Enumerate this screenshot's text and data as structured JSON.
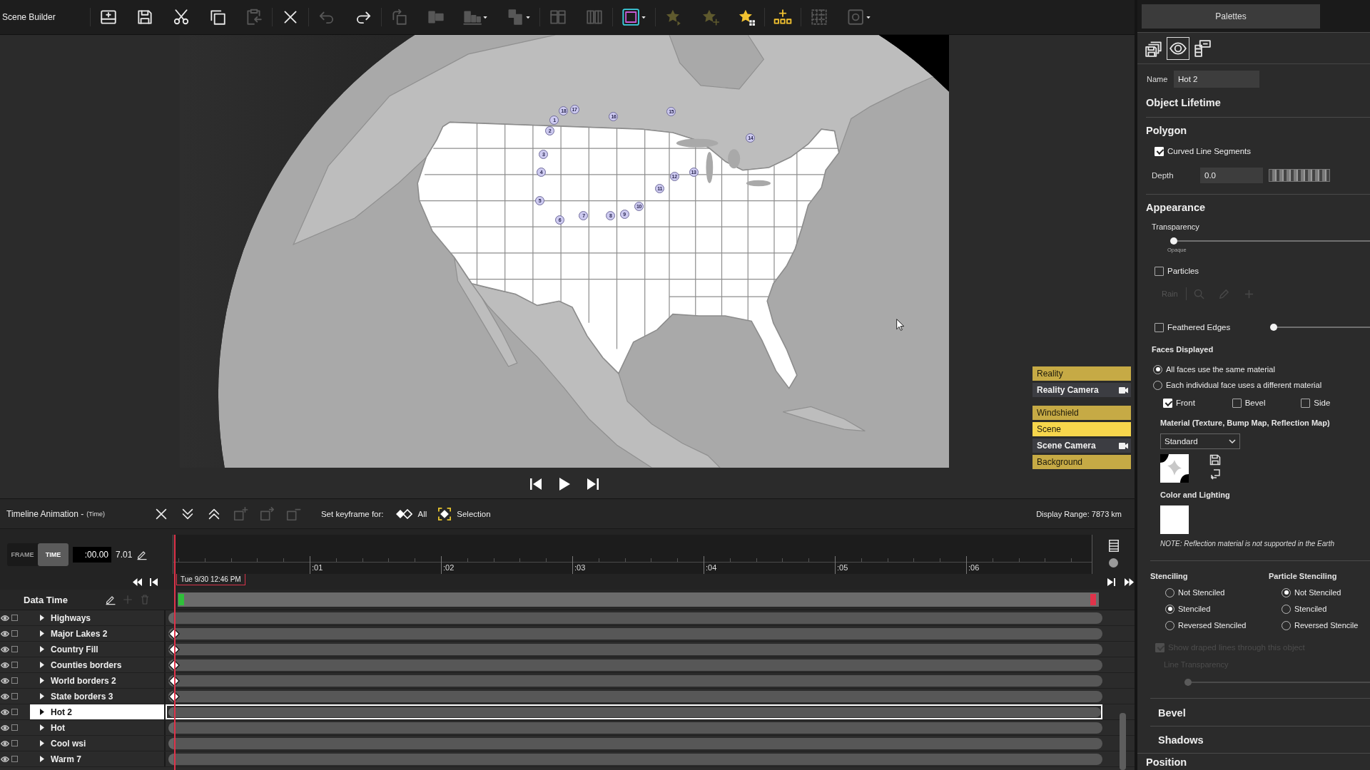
{
  "app": {
    "title": "Scene Builder"
  },
  "toolbar": {
    "groups": [
      {
        "buttons": [
          {
            "kind": "add",
            "disabled": false
          },
          {
            "kind": "save",
            "disabled": false
          },
          {
            "kind": "cut",
            "disabled": false
          },
          {
            "kind": "copy",
            "disabled": false
          },
          {
            "kind": "paste",
            "disabled": true
          }
        ]
      },
      {
        "buttons": [
          {
            "kind": "delete",
            "disabled": false
          }
        ]
      },
      {
        "buttons": [
          {
            "kind": "undo",
            "disabled": true
          },
          {
            "kind": "redo",
            "disabled": false
          }
        ]
      },
      {
        "buttons": [
          {
            "kind": "rotate",
            "disabled": true
          },
          {
            "kind": "align",
            "disabled": true
          },
          {
            "kind": "distribute",
            "disabled": true
          },
          {
            "kind": "group",
            "disabled": true
          }
        ]
      },
      {
        "buttons": [
          {
            "kind": "columns",
            "disabled": true
          },
          {
            "kind": "rows",
            "disabled": true
          }
        ]
      },
      {
        "buttons": [
          {
            "kind": "frame",
            "disabled": false
          }
        ]
      },
      {
        "buttons": [
          {
            "kind": "star",
            "disabled": true
          },
          {
            "kind": "starplus",
            "disabled": true
          },
          {
            "kind": "stargrid",
            "disabled": false
          }
        ]
      },
      {
        "buttons": [
          {
            "kind": "dots",
            "disabled": false
          }
        ]
      },
      {
        "buttons": [
          {
            "kind": "grid",
            "disabled": true
          },
          {
            "kind": "link",
            "disabled": true
          }
        ]
      }
    ]
  },
  "viewport": {
    "markers": [
      "1",
      "2",
      "3",
      "4",
      "5",
      "6",
      "7",
      "8",
      "9",
      "10",
      "11",
      "12",
      "13",
      "14",
      "15",
      "16",
      "17",
      "18"
    ],
    "layer_groups": [
      {
        "layers": [
          {
            "label": "Reality",
            "kind": "layer",
            "selected": false
          },
          {
            "label": "Reality Camera",
            "kind": "camera",
            "selected": false
          }
        ]
      },
      {
        "layers": [
          {
            "label": "Windshield",
            "kind": "layer",
            "selected": false
          },
          {
            "label": "Scene",
            "kind": "layer",
            "selected": true
          },
          {
            "label": "Scene Camera",
            "kind": "camera",
            "selected": false
          },
          {
            "label": "Background",
            "kind": "layer",
            "selected": false
          }
        ]
      }
    ]
  },
  "timeline": {
    "title": "Timeline Animation -",
    "subtitle": "(Time)",
    "tools": [
      {
        "kind": "close",
        "disabled": false
      },
      {
        "kind": "down",
        "disabled": false
      },
      {
        "kind": "up",
        "disabled": false
      },
      {
        "kind": "addkey",
        "disabled": true
      },
      {
        "kind": "movekey",
        "disabled": true
      },
      {
        "kind": "removekey",
        "disabled": true
      }
    ],
    "keyframe_label": "Set keyframe for:",
    "keyframe_options": [
      {
        "label": "All",
        "kind": "all"
      },
      {
        "label": "Selection",
        "kind": "selection"
      }
    ],
    "display_range": "Display Range: 7873 km",
    "modes": [
      {
        "label": "FRAME",
        "selected": false
      },
      {
        "label": "TIME",
        "selected": true
      }
    ],
    "time_value": ":00.00",
    "duration": "7.01",
    "ticks": [
      ":01",
      ":02",
      ":03",
      ":04",
      ":05",
      ":06"
    ],
    "date": "Tue 9/30 12:46 PM",
    "data_time": {
      "label": "Data Time",
      "tools": [
        {
          "kind": "edit",
          "disabled": false
        },
        {
          "kind": "add",
          "disabled": true
        },
        {
          "kind": "delete",
          "disabled": true
        }
      ]
    },
    "rows": [
      {
        "name": "Highways",
        "visible": true,
        "checked": false,
        "keyframe": false,
        "selected": false
      },
      {
        "name": "Major Lakes 2",
        "visible": true,
        "checked": false,
        "keyframe": true,
        "selected": false
      },
      {
        "name": "Country Fill",
        "visible": true,
        "checked": false,
        "keyframe": true,
        "selected": false
      },
      {
        "name": "Counties borders",
        "visible": true,
        "checked": false,
        "keyframe": true,
        "selected": false
      },
      {
        "name": "World borders 2",
        "visible": true,
        "checked": false,
        "keyframe": true,
        "selected": false
      },
      {
        "name": "State borders 3",
        "visible": true,
        "checked": false,
        "keyframe": true,
        "selected": false
      },
      {
        "name": "Hot 2",
        "visible": true,
        "checked": false,
        "keyframe": false,
        "selected": true
      },
      {
        "name": "Hot",
        "visible": true,
        "checked": false,
        "keyframe": false,
        "selected": false
      },
      {
        "name": "Cool wsi",
        "visible": true,
        "checked": false,
        "keyframe": false,
        "selected": false
      },
      {
        "name": "Warm 7",
        "visible": true,
        "checked": false,
        "keyframe": false,
        "selected": false
      }
    ]
  },
  "palettes": {
    "title": "Palettes",
    "tabs": [
      {
        "kind": "layers",
        "selected": false
      },
      {
        "kind": "view",
        "selected": true
      },
      {
        "kind": "list",
        "selected": false
      }
    ],
    "name": {
      "label": "Name",
      "value": "Hot 2"
    },
    "object_lifetime": {
      "title": "Object Lifetime"
    },
    "polygon": {
      "title": "Polygon",
      "curved": {
        "label": "Curved Line Segments",
        "checked": true
      },
      "depth": {
        "label": "Depth",
        "value": "0.0"
      }
    },
    "appearance": {
      "title": "Appearance",
      "transparency": {
        "label": "Transparency",
        "level": 0.0,
        "min_label": "Opaque"
      },
      "particles": {
        "label": "Particles",
        "checked": false
      },
      "particle_type": {
        "value": "Rain",
        "disabled": true
      },
      "feathered": {
        "label": "Feathered Edges",
        "checked": false,
        "level": 0.0
      },
      "faces": {
        "title": "Faces Displayed",
        "options": [
          {
            "label": "All faces use the same material",
            "selected": true
          },
          {
            "label": "Each individual face uses a different material",
            "selected": false
          }
        ],
        "sides": [
          {
            "label": "Front",
            "checked": true
          },
          {
            "label": "Bevel",
            "checked": false
          },
          {
            "label": "Side",
            "checked": false
          }
        ]
      },
      "material": {
        "title": "Material (Texture, Bump Map, Reflection Map)",
        "value": "Standard"
      },
      "color_lighting": {
        "title": "Color and Lighting"
      },
      "note": "NOTE: Reflection material is not supported in the Earth"
    },
    "stenciling": {
      "groups": [
        {
          "title": "Stenciling",
          "options": [
            {
              "label": "Not Stenciled",
              "selected": false
            },
            {
              "label": "Stenciled",
              "selected": true
            },
            {
              "label": "Reversed Stenciled",
              "selected": false
            }
          ]
        },
        {
          "title": "Particle Stenciling",
          "options": [
            {
              "label": "Not Stenciled",
              "selected": true
            },
            {
              "label": "Stenciled",
              "selected": false
            },
            {
              "label": "Reversed Stencile",
              "selected": false
            }
          ]
        }
      ],
      "draped": {
        "label": "Show draped lines through this object",
        "checked": true,
        "disabled": true
      },
      "line_transparency": {
        "label": "Line Transparency",
        "level": 0.0,
        "disabled": true
      }
    },
    "collapsed": [
      {
        "title": "Bevel",
        "kind": "sub"
      },
      {
        "title": "Shadows",
        "kind": "sub"
      },
      {
        "title": "Position",
        "kind": "top"
      }
    ]
  }
}
